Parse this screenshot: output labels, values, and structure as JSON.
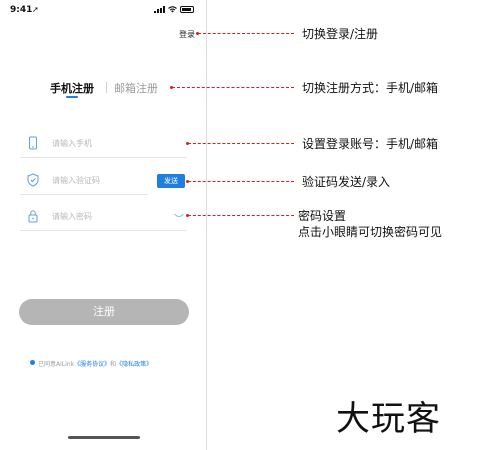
{
  "status": {
    "time": "9:41",
    "arrow": "➚"
  },
  "phone": {
    "login_switch": "登录",
    "tab_phone": "手机注册",
    "tab_email": "邮箱注册",
    "phone_placeholder": "请输入手机",
    "code_placeholder": "请输入验证码",
    "send_label": "发送",
    "password_placeholder": "请输入密码",
    "register_label": "注册",
    "agree": {
      "prefix": "已同意AiLink",
      "service": "《服务协议》",
      "and": "和",
      "privacy": "《隐私政策》"
    }
  },
  "annotations": {
    "a1": "切换登录/注册",
    "a2": "切换注册方式：手机/邮箱",
    "a3": "设置登录账号：手机/邮箱",
    "a4": "验证码发送/录入",
    "a5": "密码设置",
    "a6": "点击小眼睛可切换密码可见"
  },
  "logo": "大玩客",
  "colors": {
    "accent": "#1e7fe0",
    "annotation_line": "#d02020",
    "button_disabled": "#b5b5b5"
  }
}
